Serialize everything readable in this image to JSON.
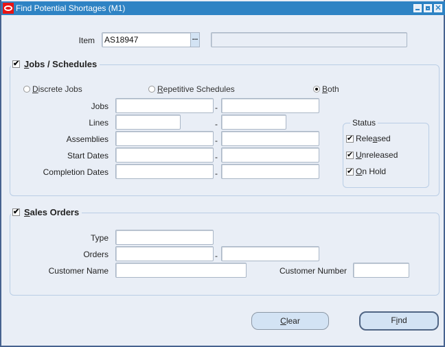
{
  "window": {
    "title": "Find Potential Shortages (M1)",
    "controls": [
      "minimize-icon",
      "maximize-icon",
      "close-icon"
    ]
  },
  "item": {
    "label": "Item",
    "value": "AS18947",
    "lov_label": "...",
    "description": ""
  },
  "jobs": {
    "checked": true,
    "title_mnemonic": "J",
    "title_rest": "obs / Schedules",
    "options": [
      {
        "mnemonic": "D",
        "rest": "iscrete Jobs",
        "selected": false
      },
      {
        "mnemonic": "R",
        "rest": "epetitive Schedules",
        "selected": false
      },
      {
        "mnemonic": "B",
        "rest": "oth",
        "selected": true
      }
    ],
    "rows": [
      {
        "label": "Jobs",
        "from": "",
        "to": ""
      },
      {
        "label": "Lines",
        "from": "",
        "to": ""
      },
      {
        "label": "Assemblies",
        "from": "",
        "to": ""
      },
      {
        "label": "Start Dates",
        "from": "",
        "to": ""
      },
      {
        "label": "Completion Dates",
        "from": "",
        "to": ""
      }
    ],
    "range_separator": "-",
    "status": {
      "title": "Status",
      "items": [
        {
          "pre": "Rele",
          "mnemonic": "a",
          "post": "sed",
          "checked": true
        },
        {
          "pre": "",
          "mnemonic": "U",
          "post": "nreleased",
          "checked": true
        },
        {
          "pre": "",
          "mnemonic": "O",
          "post": "n Hold",
          "checked": true
        }
      ]
    }
  },
  "sales": {
    "checked": true,
    "title_mnemonic": "S",
    "title_rest": "ales Orders",
    "type_label": "Type",
    "type_value": "",
    "orders_label": "Orders",
    "orders_from": "",
    "orders_to": "",
    "customer_name_label": "Customer Name",
    "customer_name_value": "",
    "customer_number_label": "Customer Number",
    "customer_number_value": ""
  },
  "buttons": {
    "clear_mnemonic": "C",
    "clear_rest": "lear",
    "find_pre": "F",
    "find_mnemonic": "i",
    "find_post": "nd"
  }
}
